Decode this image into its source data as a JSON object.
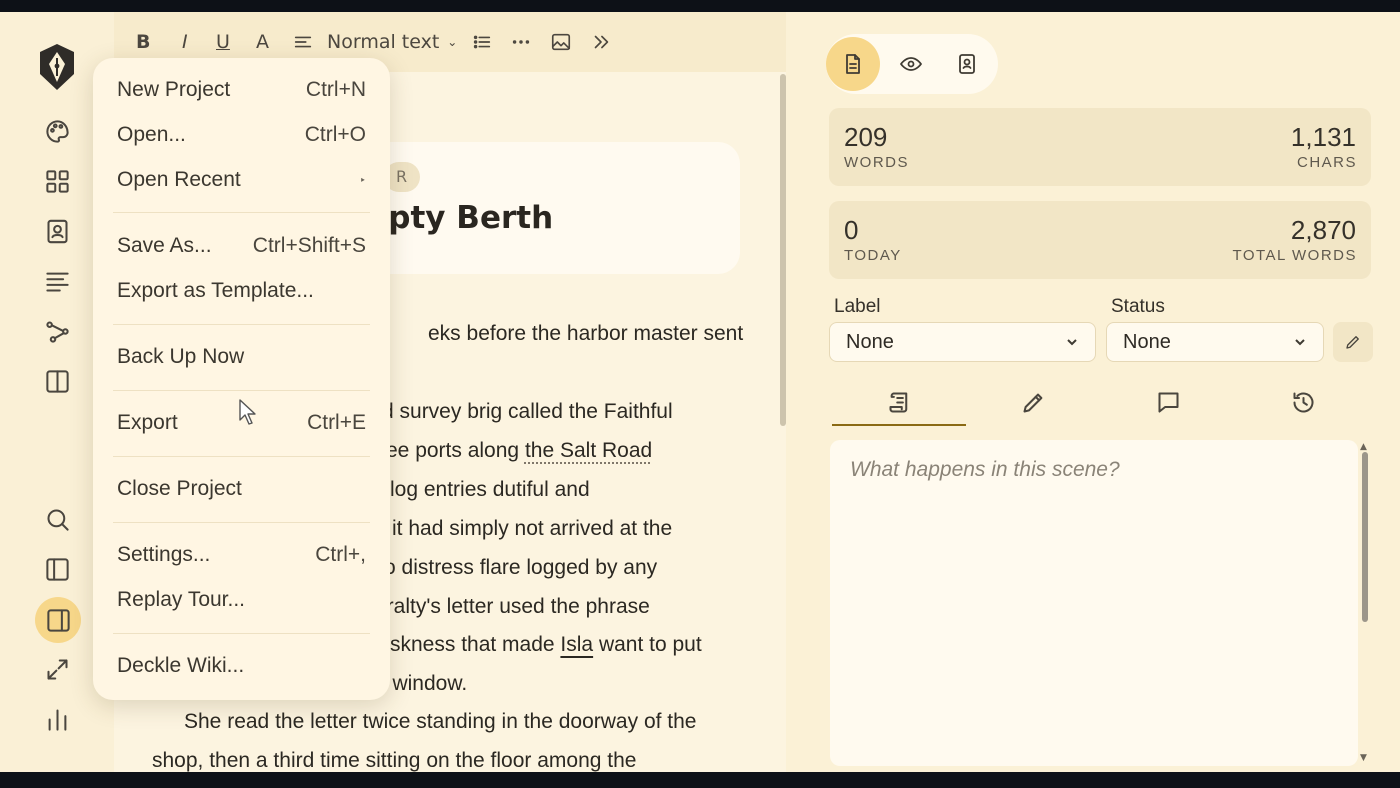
{
  "toolbar": {
    "bold": "B",
    "italic": "I",
    "underline": "U",
    "text_style": "A",
    "paragraph_style": "Normal text"
  },
  "scene": {
    "chip": "R",
    "title": "mpty Berth",
    "lines": [
      "eks before the harbor master sent",
      "d survey brig called the Faithful",
      "ee ports along ",
      "the Salt Road",
      "log entries dutiful and",
      "it had simply not arrived at the",
      "o distress flare logged by any",
      "iralty's letter used the phrase",
      "skness that made ",
      "Isla",
      " want to put",
      "her fist through the parlor window.",
      "She read the letter twice standing in the doorway of the",
      "shop, then a third time sitting on the floor among the"
    ]
  },
  "menu": {
    "items": [
      {
        "label": "New Project",
        "shortcut": "Ctrl+N"
      },
      {
        "label": "Open...",
        "shortcut": "Ctrl+O"
      },
      {
        "label": "Open Recent",
        "shortcut": "‣"
      },
      {
        "label": "Save As...",
        "shortcut": "Ctrl+Shift+S"
      },
      {
        "label": "Export as Template...",
        "shortcut": ""
      },
      {
        "label": "Back Up Now",
        "shortcut": ""
      },
      {
        "label": "Export",
        "shortcut": "Ctrl+E"
      },
      {
        "label": "Close Project",
        "shortcut": ""
      },
      {
        "label": "Settings...",
        "shortcut": "Ctrl+,"
      },
      {
        "label": "Replay Tour...",
        "shortcut": ""
      },
      {
        "label": "Deckle Wiki...",
        "shortcut": ""
      }
    ]
  },
  "stats": {
    "words": "209",
    "words_label": "WORDS",
    "chars": "1,131",
    "chars_label": "CHARS",
    "today": "0",
    "today_label": "TODAY",
    "total": "2,870",
    "total_label": "TOTAL WORDS"
  },
  "fields": {
    "label_title": "Label",
    "label_value": "None",
    "status_title": "Status",
    "status_value": "None"
  },
  "notes": {
    "placeholder": "What happens in this scene?"
  },
  "colors": {
    "accent": "#f7d78a",
    "tab_underline": "#8a6a14",
    "background": "#fbf1d6"
  }
}
